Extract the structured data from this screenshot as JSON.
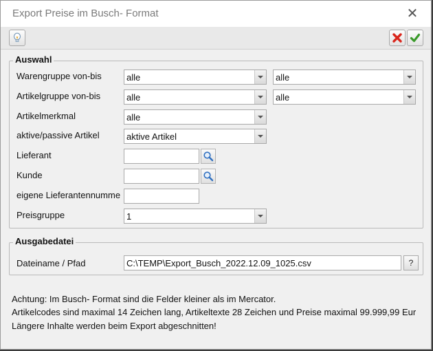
{
  "window": {
    "title": "Export Preise im Busch- Format",
    "close_glyph": "✕"
  },
  "toolbar": {
    "hint_icon": "lightbulb-icon",
    "cancel_icon": "red-x-icon",
    "confirm_icon": "green-check-icon"
  },
  "auswahl": {
    "title": "Auswahl",
    "warengruppe": {
      "label": "Warengruppe von-bis",
      "from": "alle",
      "to": "alle"
    },
    "artikelgruppe": {
      "label": "Artikelgruppe von-bis",
      "from": "alle",
      "to": "alle"
    },
    "artikelmerkmal": {
      "label": "Artikelmerkmal",
      "value": "alle"
    },
    "aktiv": {
      "label": "aktive/passive Artikel",
      "value": "aktive Artikel"
    },
    "lieferant": {
      "label": "Lieferant",
      "value": ""
    },
    "kunde": {
      "label": "Kunde",
      "value": ""
    },
    "eigene_lieferantennummer": {
      "label": "eigene Lieferantennumme",
      "value": ""
    },
    "preisgruppe": {
      "label": "Preisgruppe",
      "value": "1"
    }
  },
  "ausgabe": {
    "title": "Ausgabedatei",
    "dateiname": {
      "label": "Dateiname / Pfad",
      "value": "C:\\TEMP\\Export_Busch_2022.12.09_1025.csv"
    },
    "help_label": "?"
  },
  "notes": [
    "Achtung: Im Busch- Format sind die Felder kleiner als im Mercator.",
    "Artikelcodes sind maximal 14 Zeichen lang, Artikeltexte 28 Zeichen und Preise maximal 99.999,99 Eur",
    "Längere Inhalte werden beim Export abgeschnitten!"
  ],
  "colors": {
    "cancel": "#d9261c",
    "confirm": "#3a9a2a",
    "search": "#2f6fc0"
  }
}
